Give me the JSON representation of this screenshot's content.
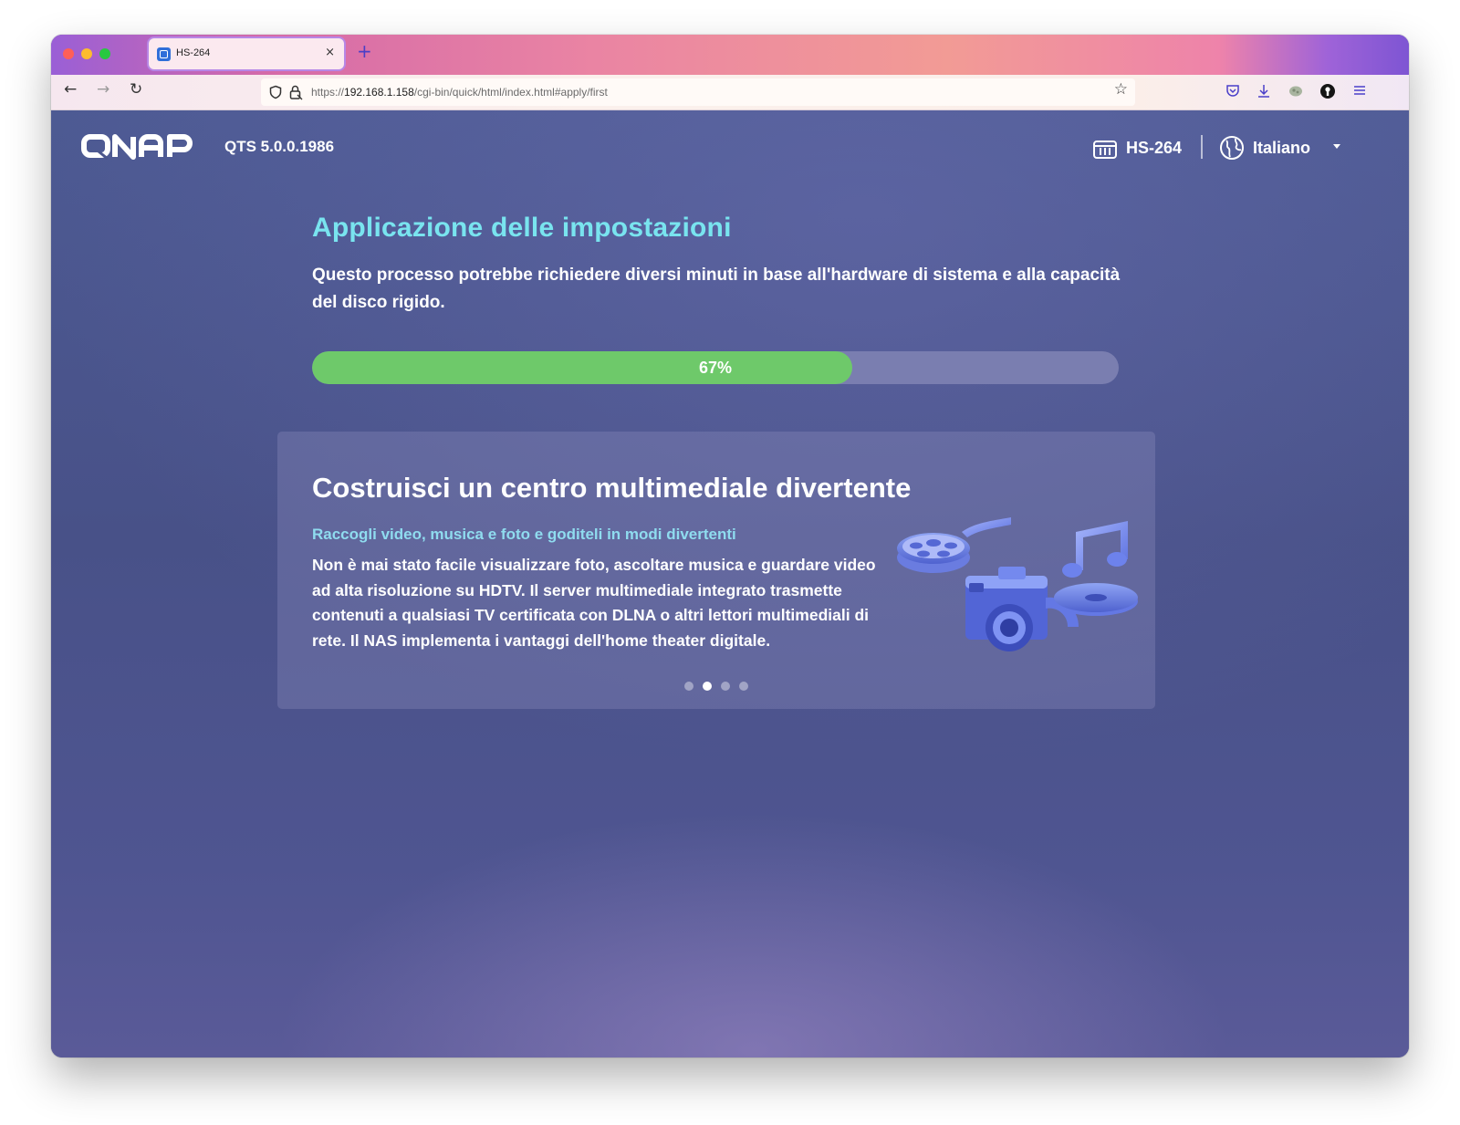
{
  "browser": {
    "tab_title": "HS-264",
    "tab_close": "×",
    "new_tab": "+",
    "nav": {
      "back": "←",
      "forward": "→",
      "reload": "↻"
    },
    "url": {
      "scheme": "https://",
      "host": "192.168.1.158",
      "path": "/cgi-bin/quick/html/index.html#apply/first"
    },
    "bookmark_star": "☆",
    "toolbar_icons": [
      "shield-icon",
      "lock-icon",
      "star-icon",
      "pocket-icon",
      "download-icon",
      "extension-icon",
      "profile-icon",
      "menu-icon"
    ]
  },
  "header": {
    "brand": "QNAP",
    "version": "QTS 5.0.0.1986",
    "device": "HS-264",
    "language": "Italiano"
  },
  "apply": {
    "title": "Applicazione delle impostazioni",
    "description": "Questo processo potrebbe richiedere diversi minuti in base all'hardware di sistema e alla capacità del disco rigido.",
    "progress_percent": 67,
    "progress_label": "67%"
  },
  "promo": {
    "title": "Costruisci un centro multimediale divertente",
    "subtitle": "Raccogli video, musica e foto e goditeli in modi divertenti",
    "body": "Non è mai stato facile visualizzare foto, ascoltare musica e guardare video ad alta risoluzione su HDTV. Il server multimediale integrato trasmette contenuti a qualsiasi TV certificata con DLNA o altri lettori multimediali di rete. Il NAS implementa i vantaggi dell'home theater digitale.",
    "slides_total": 4,
    "active_slide": 2
  },
  "colors": {
    "title_accent": "#79e4ef",
    "subtitle_accent": "#8fdcef",
    "progress_fill": "#6ec96a",
    "progress_track": "#7a7eb0",
    "page_background": "#4b568c"
  }
}
